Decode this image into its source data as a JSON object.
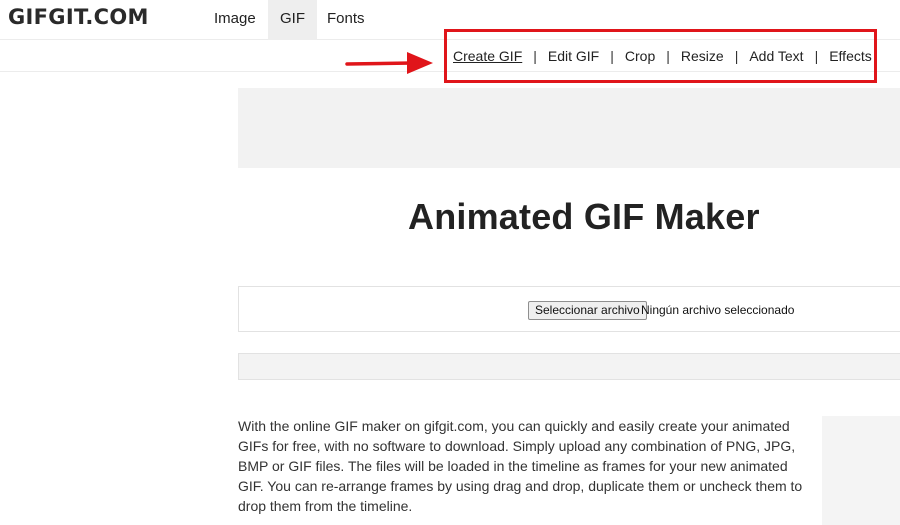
{
  "header": {
    "logo": "GIFGIT.COM",
    "nav": [
      {
        "label": "Image"
      },
      {
        "label": "GIF"
      },
      {
        "label": "Fonts"
      }
    ]
  },
  "subnav": {
    "items": [
      {
        "label": "Create GIF"
      },
      {
        "label": "Edit GIF"
      },
      {
        "label": "Crop"
      },
      {
        "label": "Resize"
      },
      {
        "label": "Add Text"
      },
      {
        "label": "Effects"
      }
    ],
    "separator": "|",
    "highlight_color": "#e0151a"
  },
  "main": {
    "title": "Animated GIF Maker",
    "file_button": "Seleccionar archivo",
    "file_status": "Ningún archivo seleccionado",
    "description": "With the online GIF maker on gifgit.com, you can quickly and easily create your animated GIFs for free, with no software to download. Simply upload any combination of PNG, JPG, BMP or GIF files. The files will be loaded in the timeline as frames for your new animated GIF. You can re-arrange frames by using drag and drop, duplicate them or uncheck them to drop them from the timeline."
  }
}
